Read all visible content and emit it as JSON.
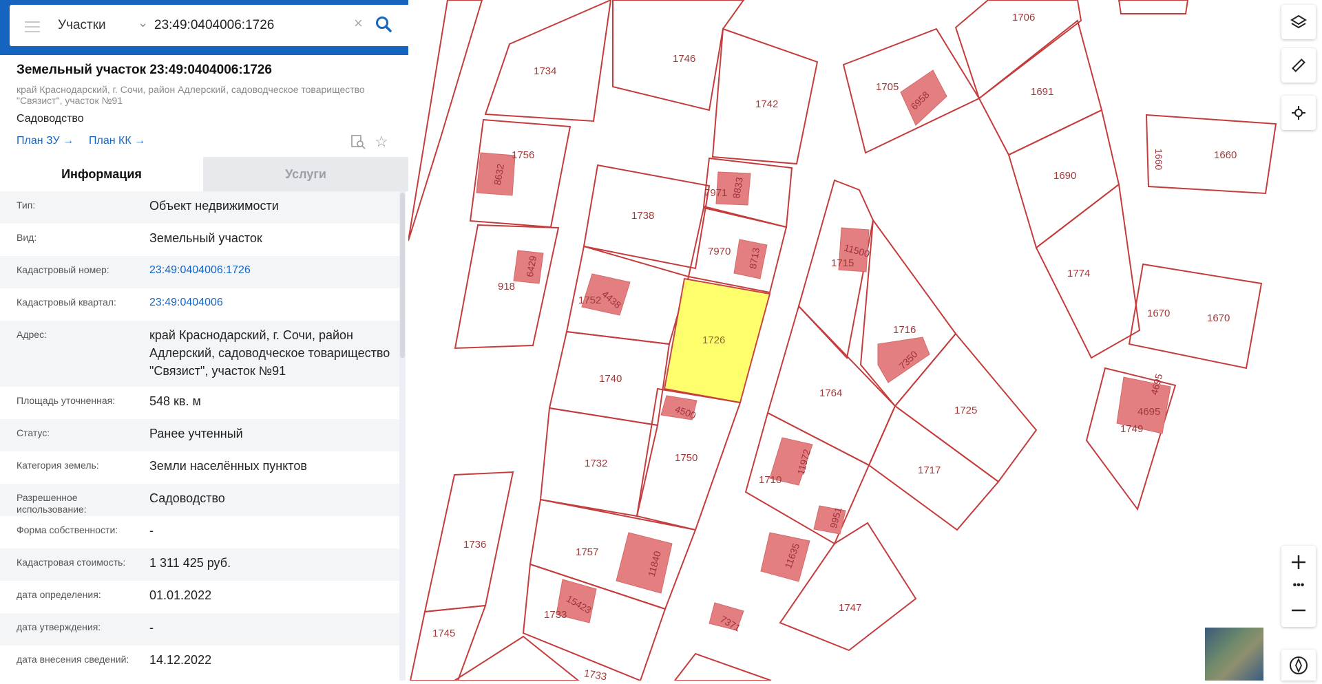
{
  "search": {
    "layer": "Участки",
    "query": "23:49:0404006:1726"
  },
  "parcel": {
    "title": "Земельный участок 23:49:0404006:1726",
    "address_line": "край Краснодарский, г. Сочи, район Адлерский, садоводческое товарищество \"Связист\", участок №91",
    "use": "Садоводство",
    "plan_zu": "План ЗУ →",
    "plan_kk": "План КК →"
  },
  "tabs": {
    "info": "Информация",
    "services": "Услуги"
  },
  "info": [
    {
      "label": "Тип:",
      "value": "Объект недвижимости"
    },
    {
      "label": "Вид:",
      "value": "Земельный участок"
    },
    {
      "label": "Кадастровый номер:",
      "value": "23:49:0404006:1726"
    },
    {
      "label": "Кадастровый квартал:",
      "value": "23:49:0404006"
    },
    {
      "label": "Адрес:",
      "value": "край Краснодарский, г. Сочи, район Адлерский, садоводческое товарищество \"Связист\", участок №91"
    },
    {
      "label": "Площадь уточненная:",
      "value": "548 кв. м"
    },
    {
      "label": "Статус:",
      "value": "Ранее учтенный"
    },
    {
      "label": "Категория земель:",
      "value": "Земли населённых пунктов"
    },
    {
      "label": "Разрешенное использование:",
      "value": "Садоводство"
    },
    {
      "label": "Форма собственности:",
      "value": "-"
    },
    {
      "label": "Кадастровая стоимость:",
      "value": "1 311 425 руб."
    },
    {
      "label": "дата определения:",
      "value": "01.01.2022"
    },
    {
      "label": "дата утверждения:",
      "value": "-"
    },
    {
      "label": "дата внесения сведений:",
      "value": "14.12.2022"
    }
  ],
  "map": {
    "selected_color": "#ffff66",
    "plot_color": "#c43c3c",
    "labels": {
      "p1734": "1734",
      "p1746": "1746",
      "p1742": "1742",
      "p1706": "1706",
      "p1705": "1705",
      "b6958": "6958",
      "p1691": "1691",
      "p1660a": "1660",
      "p1660b": "1660",
      "p1756": "1756",
      "b8632": "8632",
      "p1690": "1690",
      "b8833": "8833",
      "p7971": "7971",
      "p1738": "1738",
      "p7970": "7970",
      "b8713": "8713",
      "b11500": "11500",
      "p1715": "1715",
      "b6429": "6429",
      "p918": "918",
      "p1774": "1774",
      "p1752": "1752",
      "b4438": "4438",
      "p1726": "1726",
      "p1716": "1716",
      "b7350": "7350",
      "p1670a": "1670",
      "p1670b": "1670",
      "p1740": "1740",
      "p1764": "1764",
      "p1725": "1725",
      "b4500": "4500",
      "b4695a": "4695",
      "b4695b": "4695",
      "p1749": "1749",
      "p1732": "1732",
      "p1750": "1750",
      "b11972": "11972",
      "p1710": "1710",
      "p1717": "1717",
      "b9951": "9951",
      "p1736": "1736",
      "p1757": "1757",
      "b11840": "11840",
      "b11635": "11635",
      "p1747": "1747",
      "b15423": "15423",
      "p1733": "1733",
      "p1745": "1745",
      "b7371": "7371",
      "p1733b": "1733"
    }
  },
  "controls": {
    "zoom_dots": "•••"
  }
}
